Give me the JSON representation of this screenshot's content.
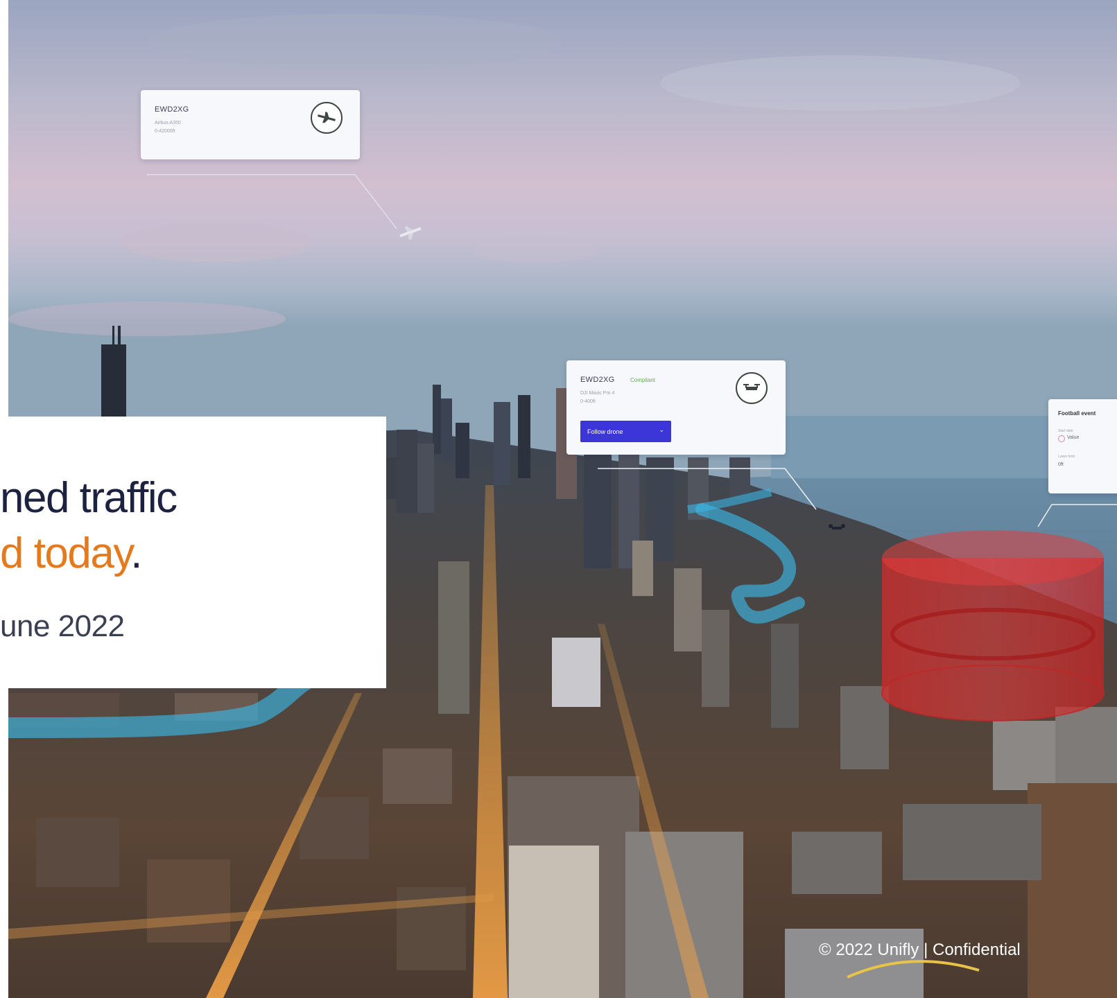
{
  "card_top": {
    "title": "EWD2XG",
    "line1": "Airbus A350",
    "line2": "0-42000ft",
    "icon": "plane-icon"
  },
  "card_middle": {
    "title": "EWD2XG",
    "status": "Compliant",
    "line1": "DJI Mavic Pro 4",
    "line2": "0-400ft",
    "button_label": "Follow drone",
    "button_icon": "chevron-down-icon",
    "icon": "drone-icon"
  },
  "card_right": {
    "title": "Football event",
    "field1_label": "Start date",
    "field1_value": "Value",
    "field2_label": "Lower limit",
    "field2_value": "0ft"
  },
  "headline": {
    "line1": "ned traffic",
    "line2_accent": "d today",
    "line2_tail": ".",
    "date": "une 2022"
  },
  "footer": {
    "text": "© 2022 Unifly | Confidential"
  },
  "colors": {
    "accent_orange": "#e47a1d",
    "headline_navy": "#1c2240",
    "button_blue": "#3c36d8",
    "status_green": "#55b44f",
    "restricted_zone": "#d42a2a",
    "flight_path": "#3ab6e3"
  }
}
